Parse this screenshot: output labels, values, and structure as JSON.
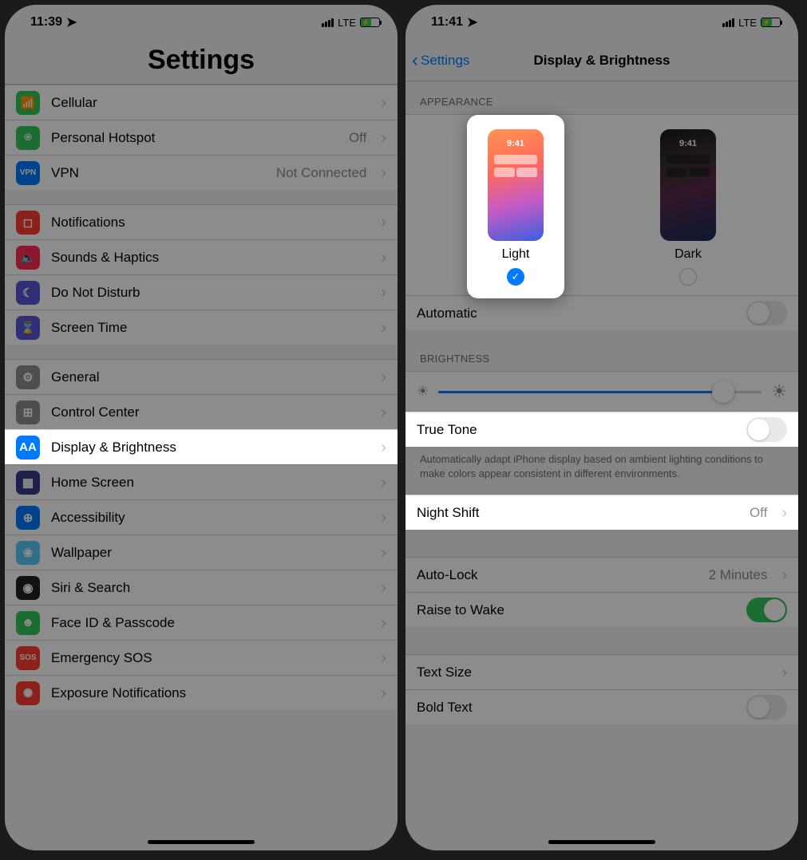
{
  "left": {
    "time": "11:39",
    "net": "LTE",
    "title": "Settings",
    "rows": [
      {
        "icon": "📶",
        "bg": "#34c759",
        "label": "Cellular",
        "value": ""
      },
      {
        "icon": "⍟",
        "bg": "#34c759",
        "label": "Personal Hotspot",
        "value": "Off"
      },
      {
        "icon": "VPN",
        "bg": "#007aff",
        "label": "VPN",
        "value": "Not Connected"
      }
    ],
    "rows2": [
      {
        "icon": "◻",
        "bg": "#ff3b30",
        "label": "Notifications"
      },
      {
        "icon": "🔈",
        "bg": "#ff2d55",
        "label": "Sounds & Haptics"
      },
      {
        "icon": "☾",
        "bg": "#5856d6",
        "label": "Do Not Disturb"
      },
      {
        "icon": "⌛",
        "bg": "#5856d6",
        "label": "Screen Time"
      }
    ],
    "rows3": [
      {
        "icon": "⚙",
        "bg": "#8e8e93",
        "label": "General"
      },
      {
        "icon": "⊞",
        "bg": "#8e8e93",
        "label": "Control Center"
      },
      {
        "icon": "AA",
        "bg": "#007aff",
        "label": "Display & Brightness",
        "hl": true
      },
      {
        "icon": "▦",
        "bg": "#3a3a8f",
        "label": "Home Screen"
      },
      {
        "icon": "⊕",
        "bg": "#007aff",
        "label": "Accessibility"
      },
      {
        "icon": "❀",
        "bg": "#5ac8fa",
        "label": "Wallpaper"
      },
      {
        "icon": "◉",
        "bg": "#222",
        "label": "Siri & Search"
      },
      {
        "icon": "☻",
        "bg": "#34c759",
        "label": "Face ID & Passcode"
      },
      {
        "icon": "SOS",
        "bg": "#ff3b30",
        "label": "Emergency SOS"
      },
      {
        "icon": "✺",
        "bg": "#ff3b30",
        "label": "Exposure Notifications"
      }
    ]
  },
  "right": {
    "time": "11:41",
    "net": "LTE",
    "back": "Settings",
    "title": "Display & Brightness",
    "sec_appearance": "APPEARANCE",
    "opt_light": "Light",
    "opt_dark": "Dark",
    "thumb_time": "9:41",
    "automatic": "Automatic",
    "sec_brightness": "BRIGHTNESS",
    "truetone": "True Tone",
    "truetone_footer": "Automatically adapt iPhone display based on ambient lighting conditions to make colors appear consistent in different environments.",
    "nightshift": "Night Shift",
    "nightshift_val": "Off",
    "autolock": "Auto-Lock",
    "autolock_val": "2 Minutes",
    "raise": "Raise to Wake",
    "textsize": "Text Size",
    "bold": "Bold Text"
  }
}
